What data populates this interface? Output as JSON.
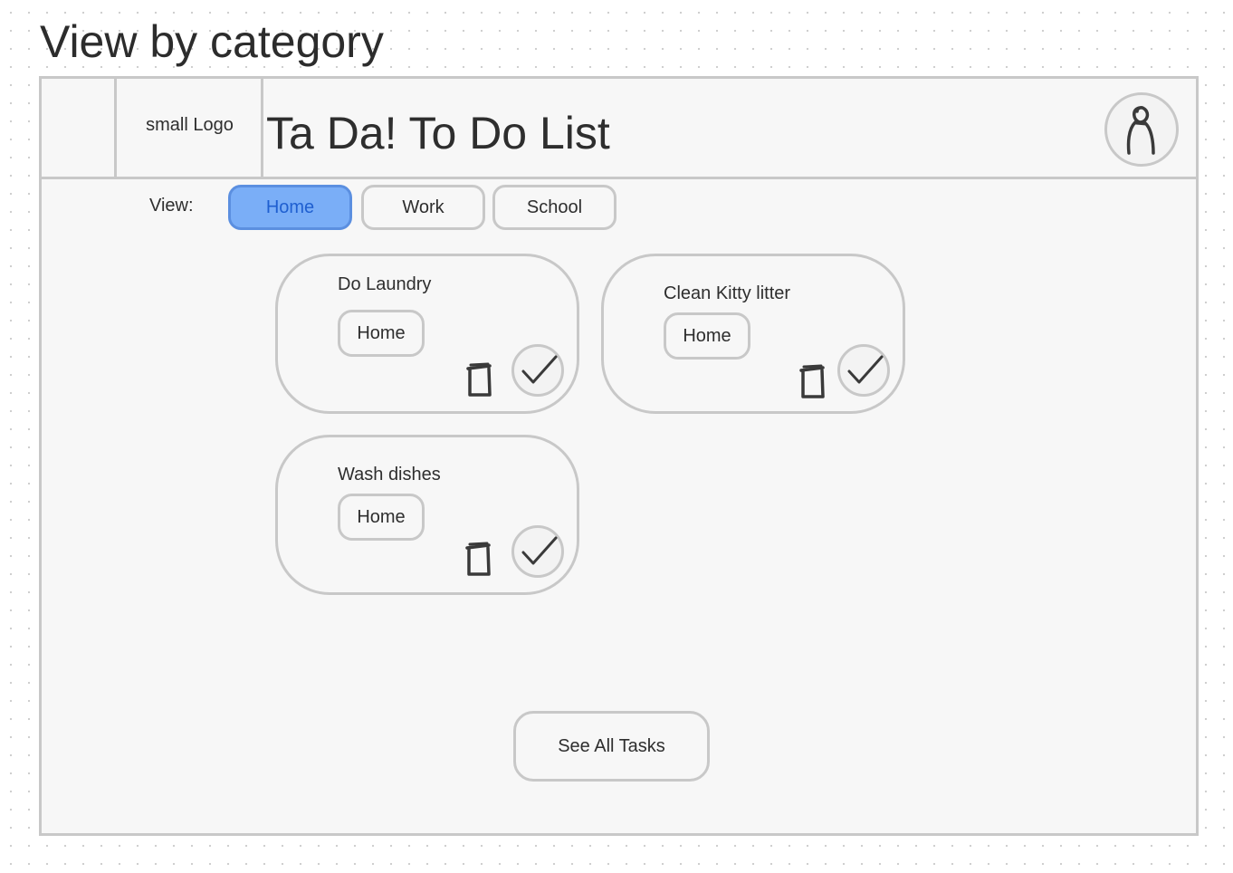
{
  "page": {
    "title": "View by category"
  },
  "header": {
    "logo_text": "small Logo",
    "app_title": "Ta Da! To Do List",
    "profile_icon": "user-icon"
  },
  "filters": {
    "label": "View:",
    "options": [
      {
        "label": "Home",
        "active": true
      },
      {
        "label": "Work",
        "active": false
      },
      {
        "label": "School",
        "active": false
      }
    ],
    "active_color": "#7aaef7",
    "active_text_color": "#1f5fd0"
  },
  "tasks": [
    {
      "title": "Do Laundry",
      "category": "Home",
      "icons": [
        "trash-icon",
        "check-icon"
      ]
    },
    {
      "title": "Clean Kitty litter",
      "category": "Home",
      "icons": [
        "trash-icon",
        "check-icon"
      ]
    },
    {
      "title": "Wash dishes",
      "category": "Home",
      "icons": [
        "trash-icon",
        "check-icon"
      ]
    }
  ],
  "footer": {
    "see_all_label": "See All Tasks"
  },
  "colors": {
    "border": "#c8c8c8",
    "panel_background": "#f7f7f7",
    "text": "#2e2e2e"
  }
}
